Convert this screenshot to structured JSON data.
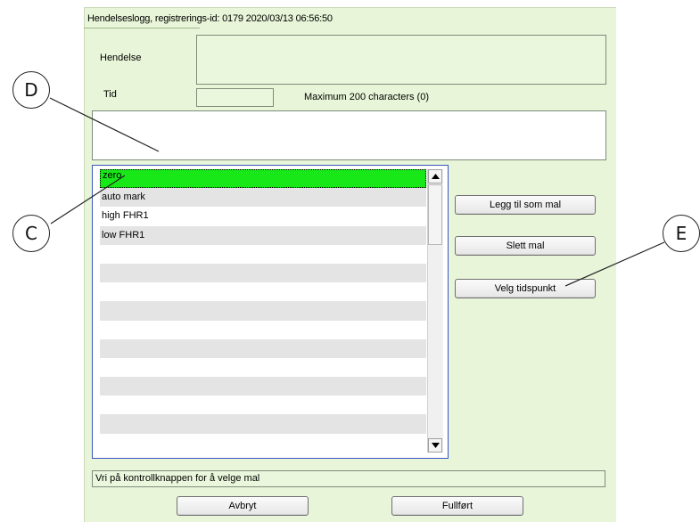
{
  "window": {
    "title": "Hendelseslogg, registrerings-id: 0179  2020/03/13 06:56:50"
  },
  "form": {
    "event_label": "Hendelse",
    "event_value": "",
    "time_label": "Tid",
    "time_value": "",
    "max_chars_text": "Maximum 200 characters (0)",
    "comment_value": ""
  },
  "template_list": {
    "items": [
      "zero",
      "auto mark",
      "high FHR1",
      "low FHR1",
      "",
      "",
      "",
      "",
      "",
      "",
      "",
      "",
      "",
      "",
      ""
    ],
    "selected_index": 0
  },
  "buttons": {
    "add_template": "Legg til som mal",
    "delete_template": "Slett mal",
    "choose_time": "Velg tidspunkt",
    "cancel": "Avbryt",
    "finish": "Fullført"
  },
  "status_bar": {
    "text": "Vri på kontrollknappen for å velge mal"
  },
  "callouts": {
    "c": "C",
    "d": "D",
    "e": "E"
  },
  "colors": {
    "panel_bg": "#e8f5d8",
    "selected_row": "#18e818",
    "list_border": "#3a56c0"
  },
  "icons": {
    "scroll_up": "triangle-up",
    "scroll_down": "triangle-down"
  }
}
